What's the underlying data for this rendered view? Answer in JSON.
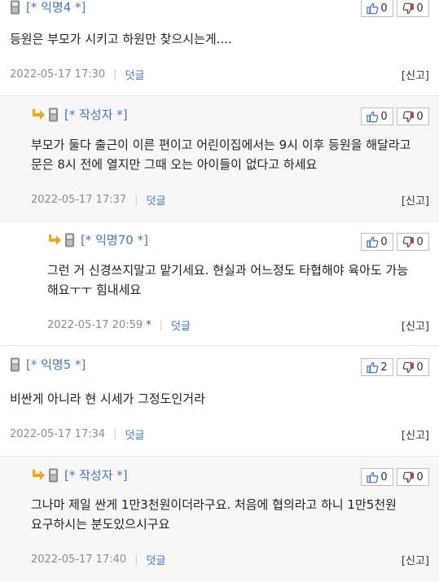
{
  "vote_icons": {
    "up": "thumbs-up-icon",
    "down": "thumbs-down-icon"
  },
  "colors": {
    "author": "#4a76b8",
    "reply_arrow": "#f0a51e",
    "reply_bg": "#f7f7f7",
    "meta": "#8c8c8c"
  },
  "comments": [
    {
      "author": "[* 익명4 *]",
      "is_reply": false,
      "upvotes": "0",
      "downvotes": "0",
      "body_lines": [
        "등원은 부모가 시키고 하원만 찾으시는게...."
      ],
      "timestamp": "2022-05-17 17:30",
      "reply_label": "덧글",
      "report_label": "[신고]"
    },
    {
      "author": "[* 작성자 *]",
      "is_reply": true,
      "upvotes": "0",
      "downvotes": "0",
      "body_lines": [
        "부모가 둘다 출근이 이른 편이고 어린이집에서는 9시 이후 등원을 해달라고",
        "문은 8시 전에 열지만 그때 오는 아이들이 없다고 하세요"
      ],
      "timestamp": "2022-05-17 17:37",
      "reply_label": "덧글",
      "report_label": "[신고]"
    },
    {
      "author": "[* 익명70 *]",
      "is_reply": true,
      "upvotes": "0",
      "downvotes": "0",
      "body_lines": [
        "그런 거 신경쓰지말고 맡기세요. 현실과 어느정도 타협해야 육아도 가능",
        "해요ㅜㅜ 힘내세요"
      ],
      "timestamp": "2022-05-17 20:59",
      "edited_mark": "*",
      "reply_label": "덧글",
      "report_label": "[신고]"
    },
    {
      "author": "[* 익명5 *]",
      "is_reply": false,
      "upvotes": "2",
      "downvotes": "0",
      "body_lines": [
        "비싼게 아니라 현 시세가 그정도인거라"
      ],
      "timestamp": "2022-05-17 17:34",
      "reply_label": "덧글",
      "report_label": "[신고]"
    },
    {
      "author": "[* 작성자 *]",
      "is_reply": true,
      "upvotes": "0",
      "downvotes": "0",
      "body_lines": [
        "그나마 제일 싼게 1만3천원이더라구요. 처음에 협의라고 하니 1만5천원",
        "요구하시는 분도있으시구요"
      ],
      "timestamp": "2022-05-17 17:40",
      "reply_label": "덧글",
      "report_label": "[신고]"
    }
  ]
}
